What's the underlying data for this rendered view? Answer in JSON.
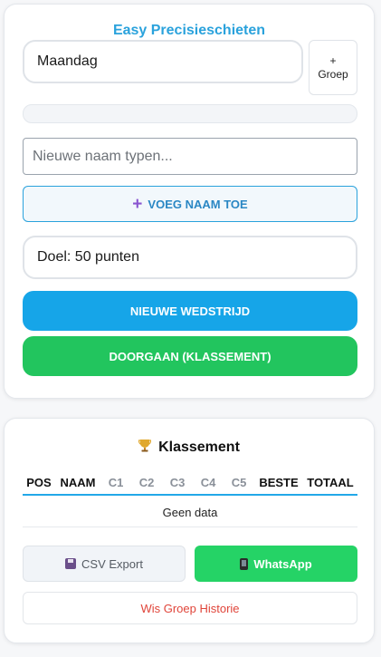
{
  "app": {
    "title": "Easy Precisieschieten"
  },
  "controls": {
    "group_value": "Maandag",
    "add_group_plus": "+",
    "add_group_label": "Groep",
    "progress": 0,
    "name_placeholder": "Nieuwe naam typen...",
    "add_name_icon": "+",
    "add_name_label": "VOEG NAAM TOE",
    "goal_label": "Doel: 50 punten",
    "new_match_label": "NIEUWE WEDSTRIJD",
    "continue_label": "DOORGAAN (KLASSEMENT)"
  },
  "ranking": {
    "icon": "trophy-icon",
    "title": "Klassement",
    "columns": [
      "POS",
      "NAAM",
      "C1",
      "C2",
      "C3",
      "C4",
      "C5",
      "BESTE",
      "TOTAAL"
    ],
    "empty_text": "Geen data",
    "csv_label": "CSV Export",
    "whatsapp_label": "WhatsApp",
    "clear_label": "Wis Groep Historie"
  },
  "colors": {
    "accent_blue": "#16a5e8",
    "accent_green": "#22c55e",
    "whatsapp_green": "#25d366",
    "danger_red": "#e0453a"
  }
}
